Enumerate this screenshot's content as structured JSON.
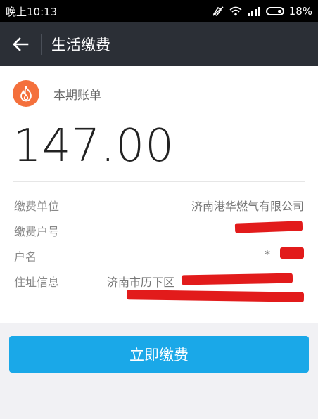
{
  "status": {
    "time": "晚上10:13",
    "battery_percent": "18%",
    "icons": [
      "mute-vibrate-icon",
      "wifi-icon",
      "signal-icon",
      "battery-icon"
    ]
  },
  "appbar": {
    "title": "生活缴费",
    "back_icon": "arrow-left-icon"
  },
  "bill": {
    "section_label": "本期账单",
    "amount": "147.00",
    "rows": [
      {
        "label": "缴费单位",
        "value": "济南港华燃气有限公司"
      },
      {
        "label": "缴费户号",
        "value": ""
      },
      {
        "label": "户名",
        "value": "*"
      },
      {
        "label": "住址信息",
        "value": "济南市历下区"
      }
    ]
  },
  "colors": {
    "appbar": "#2b2f36",
    "accent_icon": "#f4703c",
    "button": "#1aa8e8",
    "redaction": "#e21b1b"
  },
  "actions": {
    "pay_label": "立即缴费"
  }
}
